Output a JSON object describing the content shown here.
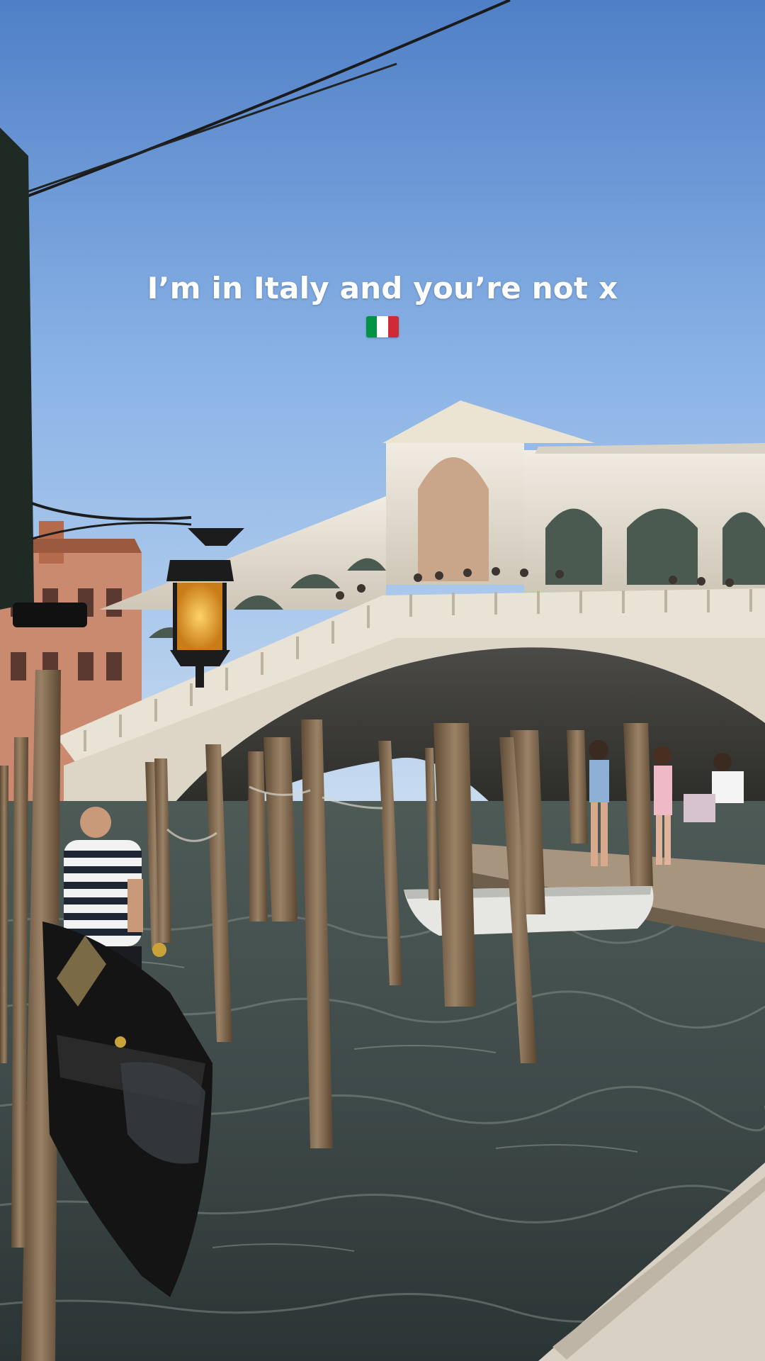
{
  "caption": {
    "text": "I’m in Italy and you’re not x",
    "emoji": "italian-flag"
  },
  "flag": {
    "green": "#009246",
    "white": "#ffffff",
    "red": "#ce2b37"
  }
}
